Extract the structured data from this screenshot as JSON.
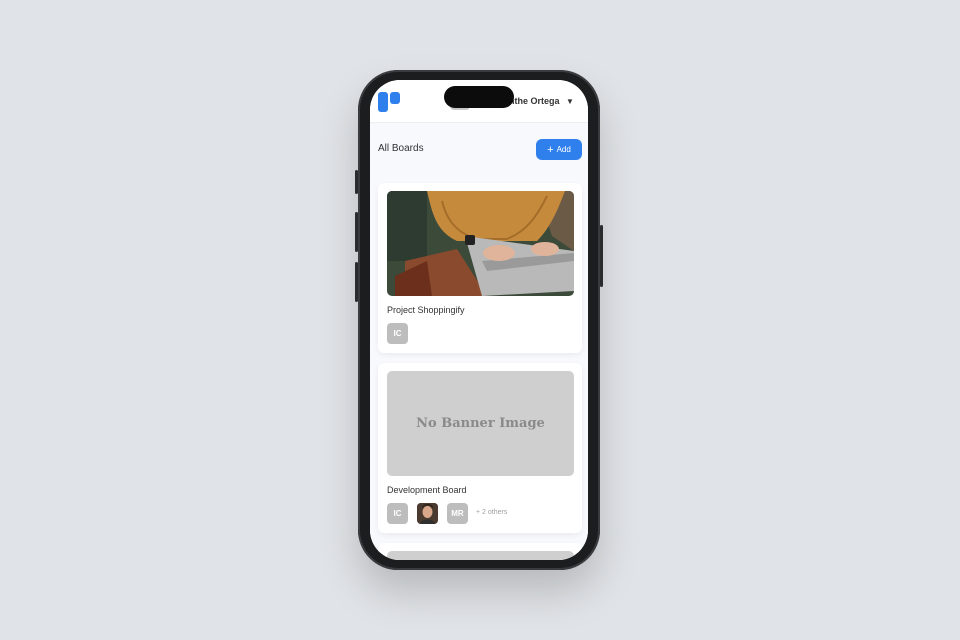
{
  "header": {
    "username": "Xanthe Ortega"
  },
  "page": {
    "title": "All Boards",
    "add_label": "Add"
  },
  "boards": [
    {
      "title": "Project Shoppingify",
      "banner": "photo",
      "members": [
        "IC"
      ]
    },
    {
      "title": "Development Board",
      "banner_placeholder": "No Banner Image",
      "members": [
        "IC",
        "MR"
      ],
      "others": "+ 2 others"
    }
  ],
  "colors": {
    "accent": "#2f80ed",
    "avatar_placeholder": "#bdbdbd",
    "banner_placeholder": "#cfcfcf"
  }
}
